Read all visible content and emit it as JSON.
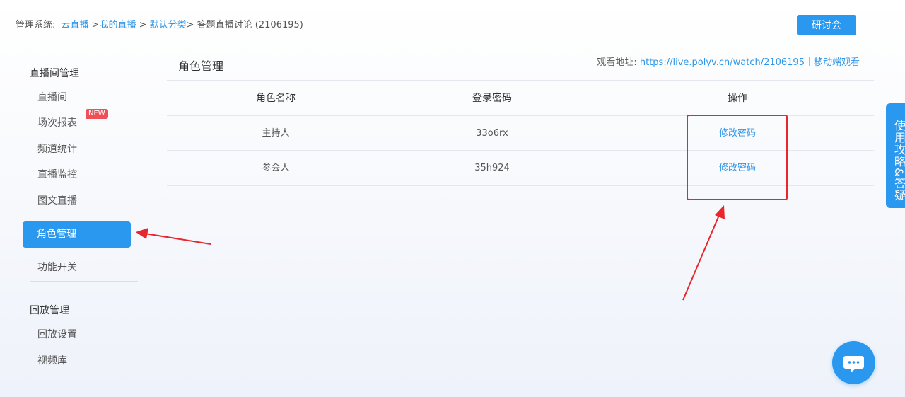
{
  "breadcrumb": {
    "prefix": "管理系统:",
    "item1": "云直播",
    "sep1": " >",
    "item2": "我的直播",
    "sep2": " > ",
    "item3": "默认分类",
    "sep3": "> ",
    "current": "答题直播讨论 (2106195)"
  },
  "top_button": "研讨会",
  "sidebar": {
    "group1_title": "直播间管理",
    "items": [
      "直播间",
      "场次报表",
      "频道统计",
      "直播监控",
      "图文直播",
      "角色管理",
      "功能开关"
    ],
    "new_badge": "NEW",
    "group2_title": "回放管理",
    "items2": [
      "回放设置",
      "视频库"
    ]
  },
  "main": {
    "title": "角色管理",
    "watch_label": "观看地址:",
    "watch_url": "https://live.polyv.cn/watch/2106195",
    "mobile_watch": "移动端观看"
  },
  "table": {
    "headers": [
      "角色名称",
      "登录密码",
      "操作"
    ],
    "rows": [
      {
        "name": "主持人",
        "password": "33o6rx",
        "action": "修改密码"
      },
      {
        "name": "参会人",
        "password": "35h924",
        "action": "修改密码"
      }
    ]
  },
  "help_tab": "使用攻略&答疑",
  "colors": {
    "accent": "#2b98f0",
    "link": "#2f95e8",
    "annotation_red": "#e8262b",
    "new_badge": "#f05055"
  },
  "icons": {
    "chat": "chat-bubble-icon"
  }
}
